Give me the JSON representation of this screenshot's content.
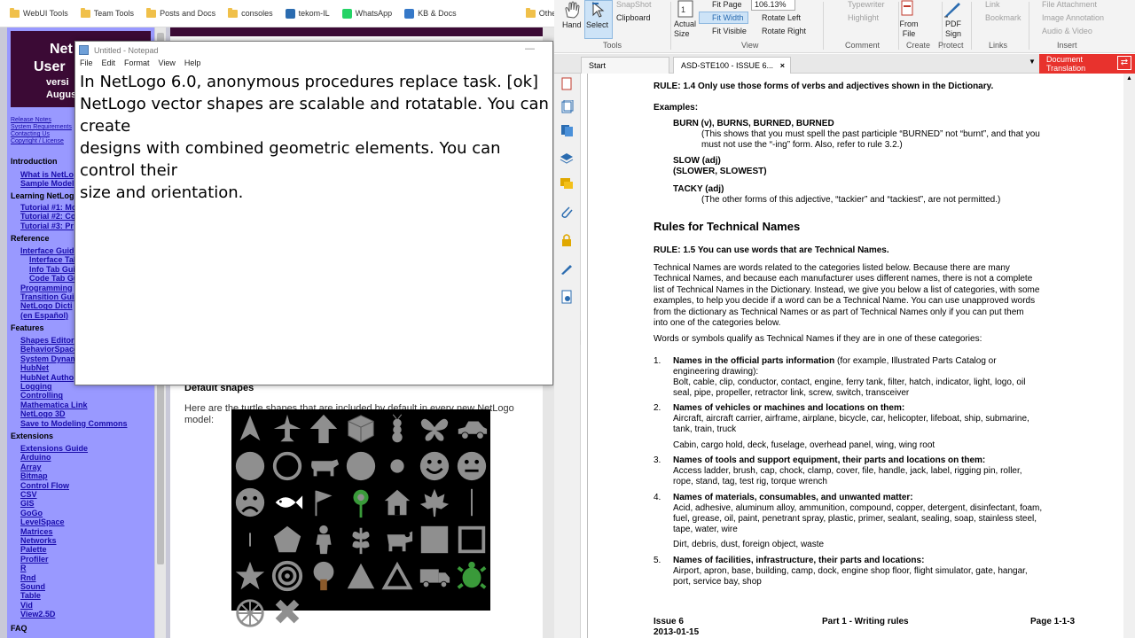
{
  "bookmarks": [
    {
      "label": "WebUI Tools",
      "icon": "folder-icon"
    },
    {
      "label": "Team Tools",
      "icon": "folder-icon"
    },
    {
      "label": "Posts and Docs",
      "icon": "folder-icon"
    },
    {
      "label": "consoles",
      "icon": "folder-icon"
    },
    {
      "label": "tekom-IL",
      "icon": "globe-icon"
    },
    {
      "label": "WhatsApp",
      "icon": "whatsapp-icon"
    },
    {
      "label": "KB & Docs",
      "icon": "doc-icon"
    },
    {
      "label": "Other bookmarks",
      "icon": "folder-icon"
    }
  ],
  "netlogo": {
    "banner": {
      "l1": "Net",
      "l2": "User",
      "l3": "versi",
      "l4": "August"
    },
    "small_links": [
      "Release Notes",
      "System Requirements",
      "Contacting Us",
      "Copyright / License"
    ],
    "sections": {
      "introduction": "Introduction",
      "learning": "Learning NetLog",
      "reference": "Reference",
      "features": "Features",
      "extensions": "Extensions",
      "faq": "FAQ"
    },
    "links": {
      "intro": [
        "What is NetLo",
        "Sample Model"
      ],
      "learning": [
        "Tutorial #1: Mo",
        "Tutorial #2: Co",
        "Tutorial #3: Pr"
      ],
      "reference": [
        "Interface Guid",
        "Interface Tab",
        "Info Tab Gui",
        "Code Tab Gu",
        "Programming",
        "Transition Gui",
        "NetLogo Dicti",
        "(en Español)"
      ],
      "features": [
        "Shapes Editor",
        "BehaviorSpace",
        "System Dynam",
        "HubNet",
        "HubNet Autho",
        "Logging",
        "Controlling",
        "Mathematica Link",
        "NetLogo 3D",
        "Save to Modeling Commons"
      ],
      "extensions": [
        "Extensions Guide",
        "Arduino",
        "Array",
        "Bitmap",
        "Control Flow",
        "CSV",
        "GIS",
        "GoGo",
        "LevelSpace",
        "Matrices",
        "Networks",
        "Palette",
        "Profiler",
        "R",
        "Rnd",
        "Sound",
        "Table",
        "Vid",
        "View2.5D"
      ]
    },
    "heading": "Default shapes",
    "paragraph": "Here are the turtle shapes that are included by default in every new NetLogo model:"
  },
  "notepad": {
    "title": "Untitled - Notepad",
    "menu": [
      "File",
      "Edit",
      "Format",
      "View",
      "Help"
    ],
    "text": "In NetLogo 6.0, anonymous procedures replace task. [ok]\nNetLogo vector shapes are scalable and rotatable. You can create\ndesigns with combined geometric elements. You can control their\nsize and orientation."
  },
  "foxit": {
    "ribbon": {
      "hand": "Hand",
      "select": "Select",
      "snapshot": "SnapShot",
      "clipboard": "Clipboard",
      "actual_size": "Actual Size",
      "fit_page": "Fit Page",
      "fit_width": "Fit Width",
      "fit_visible": "Fit Visible",
      "zoom": "106.13%",
      "rotate_left": "Rotate Left",
      "rotate_right": "Rotate Right",
      "typewriter": "Typewriter",
      "highlight": "Highlight",
      "from_file": "From File",
      "pdf_sign": "PDF Sign",
      "link": "Link",
      "bookmark": "Bookmark",
      "file_attachment": "File Attachment",
      "image_annotation": "Image Annotation",
      "audio_video": "Audio & Video",
      "groups": {
        "tools": "Tools",
        "view": "View",
        "comment": "Comment",
        "create": "Create",
        "protect": "Protect",
        "links": "Links",
        "insert": "Insert"
      }
    },
    "tabs": [
      {
        "label": "Start"
      },
      {
        "label": "ASD-STE100 - ISSUE 6..."
      }
    ],
    "doc_translation": "Document Translation",
    "doc": {
      "rule14": "RULE: 1.4    Only use those forms of verbs and adjectives shown in the Dictionary.",
      "examples": "Examples:",
      "burn_head": "BURN (v), BURNS, BURNED, BURNED",
      "burn_1": "(This shows that you must spell the past participle “BURNED” not “burnt”, and that you",
      "burn_2": "must not use the “-ing” form. Also, refer to rule 3.2.)",
      "slow_1": "SLOW (adj)",
      "slow_2": "(SLOWER, SLOWEST)",
      "tacky_head": "TACKY (adj)",
      "tacky_1": "(The other forms of this adjective, “tackier” and “tackiest”, are not permitted.)",
      "section_title": "Rules for Technical Names",
      "rule15": "RULE: 1.5    You can use words that are Technical Names.",
      "p1": [
        "Technical Names are words related to the categories listed below. Because there are many",
        "Technical Names, and because each manufacturer uses different names, there is not a complete",
        "list of Technical Names in the Dictionary. Instead, we give you below a list of categories, with some",
        "examples, to help you decide if a word can be a Technical Name. You can use unapproved words",
        "from the dictionary as Technical Names or as part of Technical Names only if you can put them",
        "into one of the categories below."
      ],
      "p2": "Words or symbols qualify as Technical Names if they are in one of these categories:",
      "items": [
        {
          "num": "1.",
          "head": "Names in the official parts information",
          "rest": " (for example, Illustrated Parts Catalog or",
          "lines": [
            "engineering drawing):",
            "Bolt, cable, clip, conductor, contact, engine, ferry tank, filter, hatch, indicator, light, logo, oil",
            "seal, pipe, propeller, retractor link, screw, switch, transceiver"
          ]
        },
        {
          "num": "2.",
          "head": "Names of vehicles or machines and locations on them:",
          "rest": "",
          "lines": [
            "Aircraft, aircraft carrier, airframe, airplane, bicycle, car, helicopter, lifeboat, ship, submarine,",
            "tank, train, truck",
            "Cabin, cargo hold, deck, fuselage, overhead panel, wing, wing root"
          ]
        },
        {
          "num": "3.",
          "head": "Names of tools and support equipment, their parts and locations on them:",
          "rest": "",
          "lines": [
            "Access ladder, brush, cap, chock, clamp, cover, file, handle, jack, label, rigging pin, roller,",
            "rope, stand, tag, test rig, torque wrench"
          ]
        },
        {
          "num": "4.",
          "head": "Names of materials, consumables, and unwanted matter:",
          "rest": "",
          "lines": [
            "Acid, adhesive, aluminum alloy, ammunition, compound, copper, detergent, disinfectant, foam,",
            "fuel, grease, oil, paint, penetrant spray, plastic, primer, sealant, sealing, soap, stainless steel,",
            "tape, water, wire",
            "Dirt, debris, dust, foreign object, waste"
          ]
        },
        {
          "num": "5.",
          "head": "Names of  facilities, infrastructure, their parts and locations:",
          "rest": "",
          "lines": [
            "Airport, apron, base, building, camp, dock, engine shop floor, flight simulator, gate, hangar,",
            "port, service bay, shop"
          ]
        }
      ],
      "footer_issue": "Issue 6",
      "footer_date": "2013-01-15",
      "footer_part": "Part 1 - Writing rules",
      "footer_page": "Page 1-1-3"
    }
  }
}
